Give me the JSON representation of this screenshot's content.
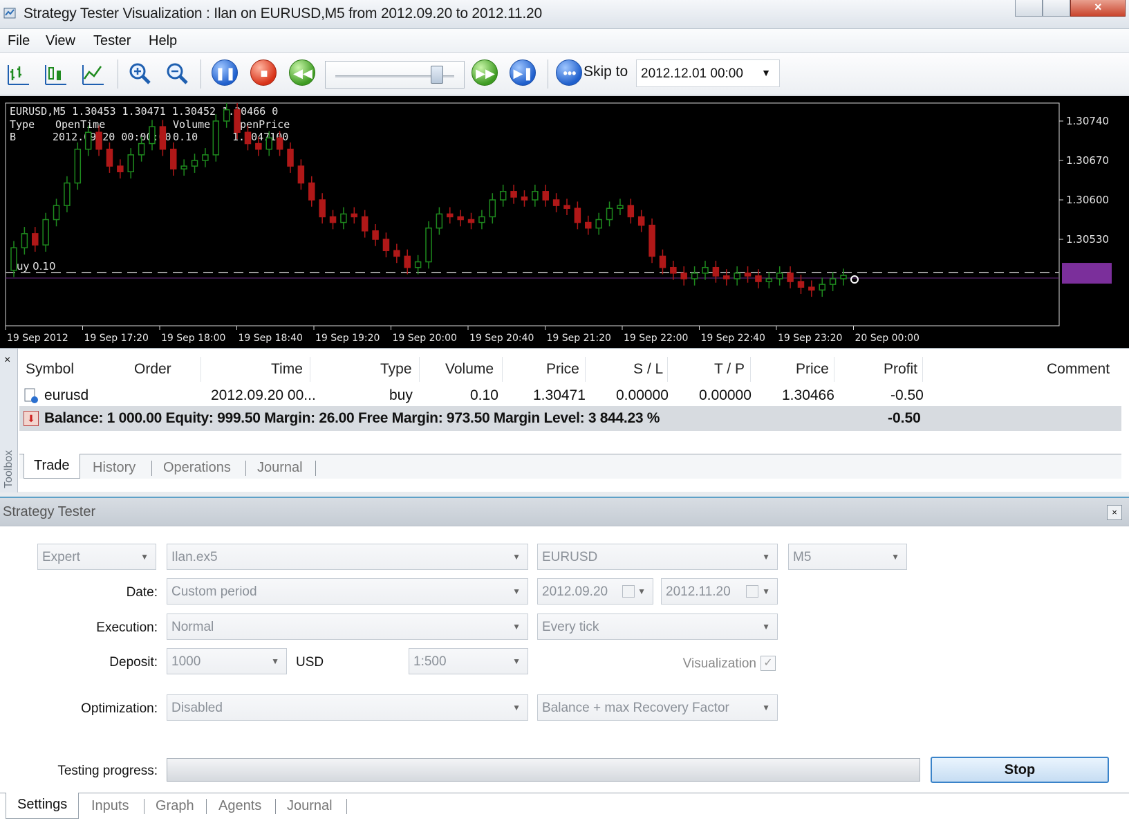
{
  "window": {
    "title": "Strategy Tester Visualization : Ilan on EURUSD,M5 from 2012.09.20 to 2012.11.20"
  },
  "menu": [
    "File",
    "View",
    "Tester",
    "Help"
  ],
  "toolbar": {
    "skip_label": "Skip to",
    "skip_date": "2012.12.01 00:00"
  },
  "chart": {
    "info_line": "EURUSD,M5  1.30453 1.30471 1.30452 1.30466  0",
    "trade_header": {
      "type": "Type",
      "open_time": "OpenTime",
      "volume": "Volume",
      "open_price": "OpenPrice"
    },
    "trade_row": {
      "type": "B",
      "open_time": "2012.09.20 00:00:00",
      "volume": "0.10",
      "open_price": "1.3047100"
    },
    "position_label": "uy 0.10",
    "y_ticks": [
      "1.30740",
      "1.30670",
      "1.30600",
      "1.30530"
    ],
    "x_ticks": [
      "19 Sep 2012",
      "19 Sep 17:20",
      "19 Sep 18:00",
      "19 Sep 18:40",
      "19 Sep 19:20",
      "19 Sep 20:00",
      "19 Sep 20:40",
      "19 Sep 21:20",
      "19 Sep 22:00",
      "19 Sep 22:40",
      "19 Sep 23:20",
      "20 Sep 00:00"
    ],
    "colors": {
      "bull": "#1e8a1e",
      "bear": "#b01818",
      "background": "#000000",
      "text": "#e8e8e8",
      "price_marker": "#7b2f9b"
    }
  },
  "trade_panel": {
    "side_label": "Toolbox",
    "close_symbol": "×",
    "columns": [
      "Symbol",
      "Order",
      "Time",
      "Type",
      "Volume",
      "Price",
      "S / L",
      "T / P",
      "Price",
      "Profit",
      "Comment"
    ],
    "row": {
      "symbol": "eurusd",
      "order": "",
      "time": "2012.09.20 00...",
      "type": "buy",
      "volume": "0.10",
      "price": "1.30471",
      "sl": "0.00000",
      "tp": "0.00000",
      "price2": "1.30466",
      "profit": "-0.50",
      "comment": ""
    },
    "balance_text": "Balance: 1 000.00  Equity: 999.50  Margin: 26.00  Free Margin: 973.50  Margin Level: 3 844.23 %",
    "balance_profit": "-0.50",
    "tabs": [
      "Trade",
      "History",
      "Operations",
      "Journal"
    ]
  },
  "strategy_tester": {
    "title": "Strategy Tester",
    "close_symbol": "×",
    "mode": "Expert",
    "expert": "Ilan.ex5",
    "symbol": "EURUSD",
    "timeframe": "M5",
    "date_label": "Date:",
    "date_mode": "Custom period",
    "date_from": "2012.09.20",
    "date_to": "2012.11.20",
    "execution_label": "Execution:",
    "execution": "Normal",
    "ticks": "Every tick",
    "deposit_label": "Deposit:",
    "deposit": "1000",
    "currency": "USD",
    "leverage": "1:500",
    "visualization_label": "Visualization",
    "optimization_label": "Optimization:",
    "optimization": "Disabled",
    "criterion": "Balance + max Recovery Factor",
    "progress_label": "Testing progress:",
    "progress": 0.0,
    "stop_label": "Stop",
    "tabs": [
      "Settings",
      "Inputs",
      "Graph",
      "Agents",
      "Journal"
    ]
  }
}
